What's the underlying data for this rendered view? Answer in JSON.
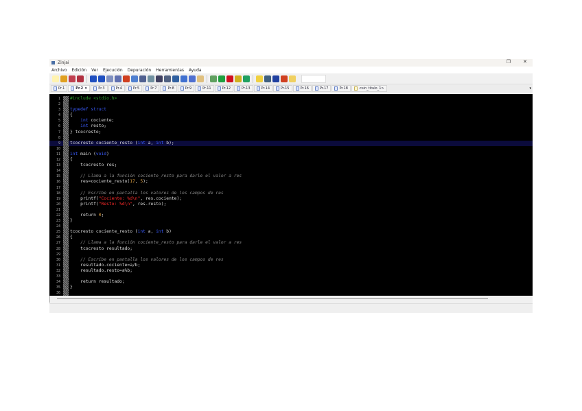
{
  "window": {
    "title": "Zinjai",
    "maximize": "❐",
    "close": "✕"
  },
  "menu": [
    "Archivo",
    "Edición",
    "Ver",
    "Ejecución",
    "Depuración",
    "Herramientas",
    "Ayuda"
  ],
  "toolbar": {
    "groups": [
      [
        {
          "icon": "new-file-icon",
          "color": "#fff3b0"
        },
        {
          "icon": "open-folder-icon",
          "color": "#e0a020"
        },
        {
          "icon": "save-icon",
          "color": "#c04050"
        },
        {
          "icon": "save-all-icon",
          "color": "#b03040"
        }
      ],
      [
        {
          "icon": "undo-icon",
          "color": "#2050c0"
        },
        {
          "icon": "redo-icon",
          "color": "#2050c0"
        },
        {
          "icon": "cut-icon",
          "color": "#8090c0"
        },
        {
          "icon": "copy-icon",
          "color": "#6070b0"
        },
        {
          "icon": "paste-icon",
          "color": "#d04020"
        },
        {
          "icon": "indent-icon",
          "color": "#5080d0"
        },
        {
          "icon": "comment-icon",
          "color": "#506090"
        },
        {
          "icon": "find-icon",
          "color": "#7090a0"
        },
        {
          "icon": "replace-icon",
          "color": "#404060"
        },
        {
          "icon": "goto-icon",
          "color": "#506080"
        },
        {
          "icon": "goto-function-icon",
          "color": "#3060a0"
        },
        {
          "icon": "bookmark-icon",
          "color": "#4070d0"
        },
        {
          "icon": "next-bookmark-icon",
          "color": "#5070d0"
        },
        {
          "icon": "doc-icon",
          "color": "#e0c080"
        }
      ],
      [
        {
          "icon": "compile-icon",
          "color": "#60a060"
        },
        {
          "icon": "run-icon",
          "color": "#20a040"
        },
        {
          "icon": "stop-icon",
          "color": "#d01020"
        },
        {
          "icon": "debug-run-icon",
          "color": "#d0b020"
        },
        {
          "icon": "inspect-icon",
          "color": "#20a060"
        }
      ],
      [
        {
          "icon": "quickhelp-icon",
          "color": "#f0d040"
        },
        {
          "icon": "tools-icon",
          "color": "#406080"
        },
        {
          "icon": "reference-icon",
          "color": "#2040a0"
        },
        {
          "icon": "help-icon",
          "color": "#d04020"
        },
        {
          "icon": "tip-icon",
          "color": "#f0d060"
        }
      ]
    ]
  },
  "tabs": [
    {
      "label": "Pr.1"
    },
    {
      "label": "Pr.2",
      "active": true,
      "close": "×"
    },
    {
      "label": "Pr.3"
    },
    {
      "label": "Pr.4"
    },
    {
      "label": "Pr.5"
    },
    {
      "label": "Pr.7"
    },
    {
      "label": "Pr.8"
    },
    {
      "label": "Pr.9"
    },
    {
      "label": "Pr.11"
    },
    {
      "label": "Pr.12"
    },
    {
      "label": "Pr.13"
    },
    {
      "label": "Pr.14"
    },
    {
      "label": "Pr.15"
    },
    {
      "label": "Pr.16"
    },
    {
      "label": "Pr.17"
    },
    {
      "label": "Pr.18"
    },
    {
      "label": "<sin_titulo_1>",
      "new": true
    }
  ],
  "tabs_menu": "▾",
  "code": [
    [
      [
        "pp",
        "#include <stdio.h>"
      ]
    ],
    [],
    [
      [
        "kw",
        "typedef"
      ],
      [
        "tx",
        " "
      ],
      [
        "kw",
        "struct"
      ]
    ],
    [
      [
        "tx",
        "{"
      ]
    ],
    [
      [
        "tx",
        "    "
      ],
      [
        "kw",
        "int"
      ],
      [
        "tx",
        " cociente;"
      ]
    ],
    [
      [
        "tx",
        "    "
      ],
      [
        "kw",
        "int"
      ],
      [
        "tx",
        " resto;"
      ]
    ],
    [
      [
        "tx",
        "} tcocresto;"
      ]
    ],
    [],
    [
      [
        "tx",
        "tcocresto cociente_resto ("
      ],
      [
        "kw",
        "int"
      ],
      [
        "tx",
        " a, "
      ],
      [
        "kw",
        "int"
      ],
      [
        "tx",
        " b);"
      ]
    ],
    [],
    [
      [
        "kw",
        "int"
      ],
      [
        "tx",
        " main ("
      ],
      [
        "kw",
        "void"
      ],
      [
        "tx",
        ")"
      ]
    ],
    [
      [
        "tx",
        "{"
      ]
    ],
    [
      [
        "tx",
        "    tcocresto res;"
      ]
    ],
    [],
    [
      [
        "tx",
        "    "
      ],
      [
        "cm",
        "// Llama a la función cociente_resto para darle el valor a res"
      ]
    ],
    [
      [
        "tx",
        "    res=cociente_resto("
      ],
      [
        "num",
        "17"
      ],
      [
        "tx",
        ", "
      ],
      [
        "num",
        "5"
      ],
      [
        "tx",
        ");"
      ]
    ],
    [],
    [
      [
        "tx",
        "    "
      ],
      [
        "cm",
        "// Escribe en pantalla los valores de los campos de res"
      ]
    ],
    [
      [
        "tx",
        "    printf("
      ],
      [
        "str",
        "\"Cociente: %d\\n\""
      ],
      [
        "tx",
        ", res.cociente);"
      ]
    ],
    [
      [
        "tx",
        "    printf("
      ],
      [
        "str",
        "\"Resto: %d\\n\""
      ],
      [
        "tx",
        ", res.resto);"
      ]
    ],
    [],
    [
      [
        "tx",
        "    return "
      ],
      [
        "num",
        "0"
      ],
      [
        "tx",
        ";"
      ]
    ],
    [
      [
        "tx",
        "}"
      ]
    ],
    [],
    [
      [
        "tx",
        "tcocresto cociente_resto ("
      ],
      [
        "kw",
        "int"
      ],
      [
        "tx",
        " a, "
      ],
      [
        "kw",
        "int"
      ],
      [
        "tx",
        " b)"
      ]
    ],
    [
      [
        "tx",
        "{"
      ]
    ],
    [
      [
        "tx",
        "    "
      ],
      [
        "cm",
        "// Llama a la función cociente_resto para darle el valor a res"
      ]
    ],
    [
      [
        "tx",
        "    tcocresto resultado;"
      ]
    ],
    [],
    [
      [
        "tx",
        "    "
      ],
      [
        "cm",
        "// Escribe en pantalla los valores de los campos de res"
      ]
    ],
    [
      [
        "tx",
        "    resultado.cociente=a/b;"
      ]
    ],
    [
      [
        "tx",
        "    resultado.resto=a%b;"
      ]
    ],
    [],
    [
      [
        "tx",
        "    return resultado;"
      ]
    ],
    [
      [
        "tx",
        "}"
      ]
    ],
    []
  ],
  "highlighted_line": 9
}
